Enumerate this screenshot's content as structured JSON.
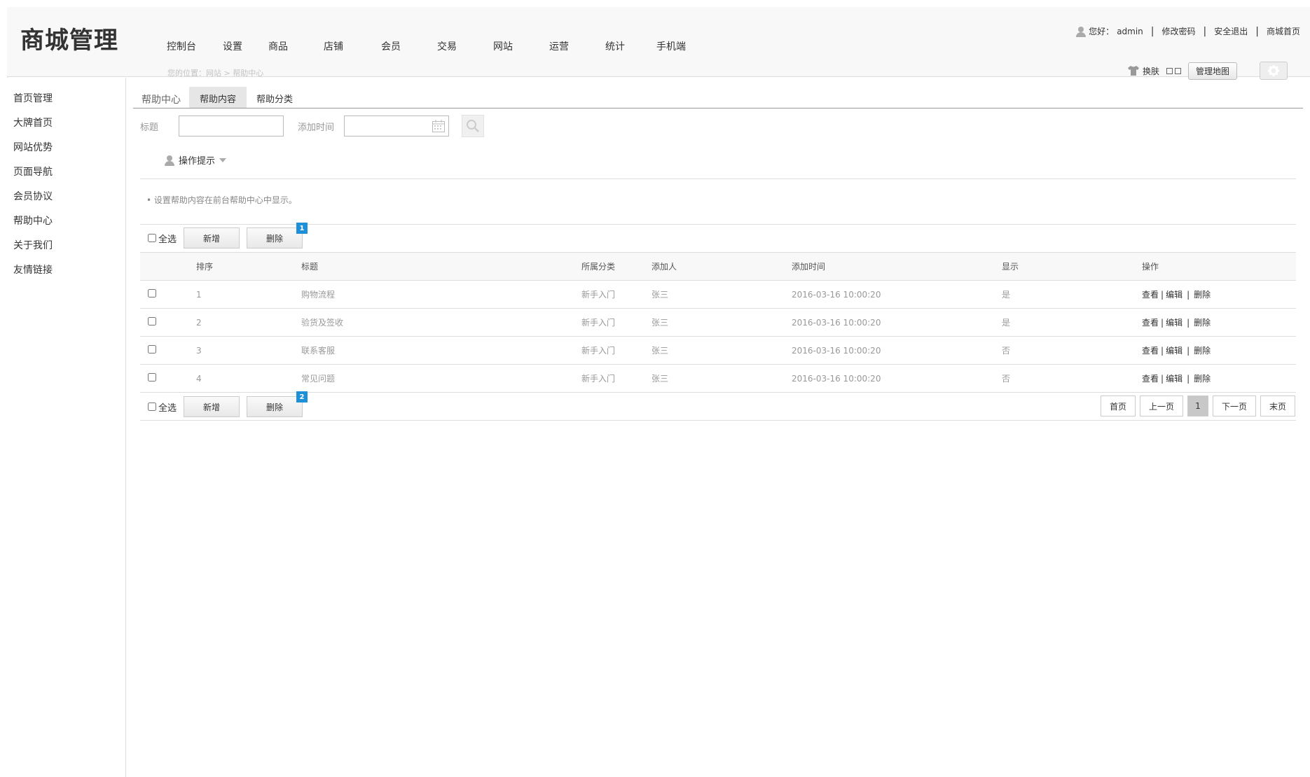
{
  "header": {
    "logo": "商城管理",
    "nav": [
      "控制台",
      "设置",
      "商品",
      "店铺",
      "会员",
      "交易",
      "网站",
      "运营",
      "统计",
      "手机端"
    ],
    "breadcrumb": "您的位置：网站 > 帮助中心",
    "greeting": "您好：",
    "username": "admin",
    "change_password": "修改密码",
    "logout": "安全退出",
    "shop_home": "商城首页",
    "skin": "换肤",
    "admin_map": "管理地图"
  },
  "sidebar": {
    "items": [
      "首页管理",
      "大牌首页",
      "网站优势",
      "页面导航",
      "会员协议",
      "帮助中心",
      "关于我们",
      "友情链接"
    ]
  },
  "tabs": {
    "title": "帮助中心",
    "items": [
      "帮助内容",
      "帮助分类"
    ]
  },
  "search": {
    "title_label": "标题",
    "title_value": "",
    "time_label": "添加时间",
    "time_value": ""
  },
  "tips": {
    "label": "操作提示",
    "text": "• 设置帮助内容在前台帮助中心中显示。"
  },
  "actions": {
    "select_all": "全选",
    "add": "新增",
    "delete": "删除",
    "badge_top": "1",
    "badge_bottom": "2"
  },
  "table": {
    "headers": [
      "排序",
      "标题",
      "所属分类",
      "添加人",
      "添加时间",
      "显示",
      "操作"
    ],
    "rows": [
      {
        "order": "1",
        "title": "购物流程",
        "category": "新手入门",
        "author": "张三",
        "time": "2016-03-16 10:00:20",
        "show": "是"
      },
      {
        "order": "2",
        "title": "验货及签收",
        "category": "新手入门",
        "author": "张三",
        "time": "2016-03-16 10:00:20",
        "show": "是"
      },
      {
        "order": "3",
        "title": "联系客服",
        "category": "新手入门",
        "author": "张三",
        "time": "2016-03-16 10:00:20",
        "show": "否"
      },
      {
        "order": "4",
        "title": "常见问题",
        "category": "新手入门",
        "author": "张三",
        "time": "2016-03-16 10:00:20",
        "show": "否"
      }
    ],
    "ops": {
      "view": "查看",
      "edit": "编辑",
      "delete": "删除"
    }
  },
  "pager": {
    "first": "首页",
    "prev": "上一页",
    "current": "1",
    "next": "下一页",
    "last": "末页"
  },
  "icons": {
    "user": "user-icon",
    "shirt": "shirt-icon",
    "gear": "gear-icon",
    "calendar": "calendar-icon",
    "search": "search-icon"
  }
}
